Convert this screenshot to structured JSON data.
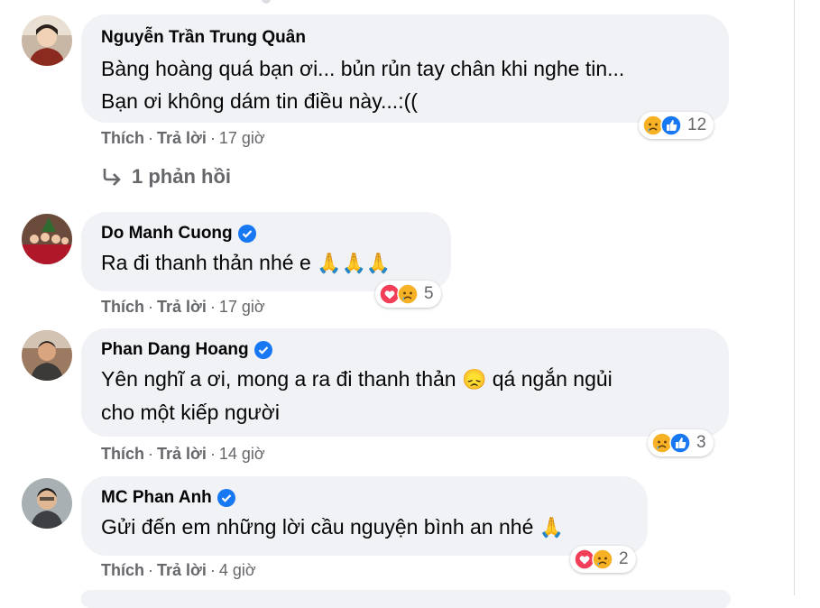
{
  "comments": [
    {
      "author": "Nguyễn Trần Trung Quân",
      "verified": false,
      "text_lines": [
        "Bàng hoàng quá bạn ơi... bủn rủn tay chân khi nghe tin...",
        "Bạn ơi không dám tin điều này...:(("
      ],
      "like": "Thích",
      "reply": "Trả lời",
      "time": "17 giờ",
      "reactions": [
        "sad-icon",
        "like-icon"
      ],
      "reaction_count": "12"
    },
    {
      "author": "Do Manh Cuong",
      "verified": true,
      "text_lines": [
        "Ra đi thanh thản nhé e"
      ],
      "emoji": "🙏🙏🙏",
      "like": "Thích",
      "reply": "Trả lời",
      "time": "17 giờ",
      "reactions": [
        "love-icon",
        "sad-icon"
      ],
      "reaction_count": "5"
    },
    {
      "author": "Phan Dang Hoang",
      "verified": true,
      "text_lines": [
        "Yên nghĩ a ơi, mong a ra đi thanh thản",
        "qá ngắn ngủi",
        "cho một kiếp người"
      ],
      "emoji": "😞",
      "like": "Thích",
      "reply": "Trả lời",
      "time": "14 giờ",
      "reactions": [
        "sad-icon",
        "like-icon"
      ],
      "reaction_count": "3"
    },
    {
      "author": "MC Phan Anh",
      "verified": true,
      "text_lines": [
        "Gửi đến em những lời cầu nguyện bình an nhé"
      ],
      "emoji": "🙏",
      "like": "Thích",
      "reply": "Trả lời",
      "time": "4 giờ",
      "reactions": [
        "love-icon",
        "sad-icon"
      ],
      "reaction_count": "2"
    }
  ],
  "replies_link": "1 phản hồi",
  "separator": "·",
  "colors": {
    "bubble": "#f0f2f5",
    "meta_text": "#65676b",
    "verified": "#1877f2",
    "like": "#1877f2",
    "love": "#f33e58",
    "sad": "#f7b125"
  }
}
